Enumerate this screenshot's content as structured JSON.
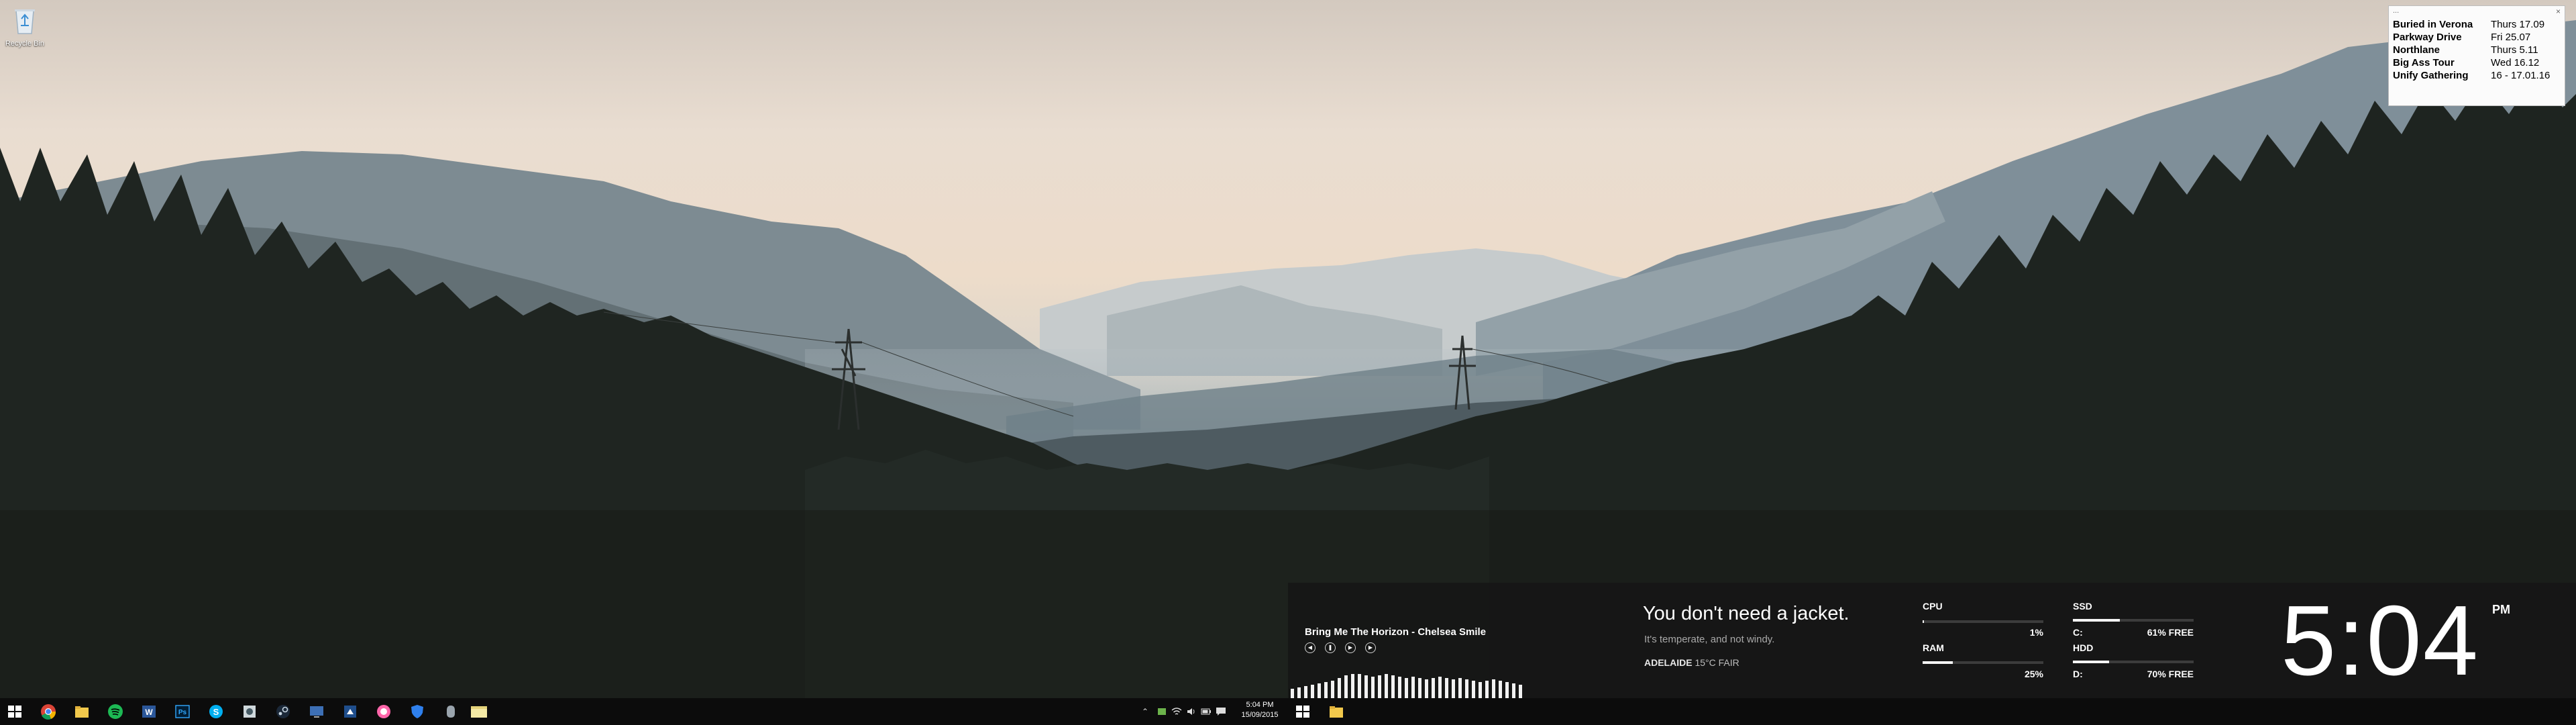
{
  "desktop": {
    "recycle_bin_label": "Recycle Bin"
  },
  "note": {
    "title_dots": "...",
    "close_glyph": "×",
    "rows": [
      {
        "band": "Buried in Verona",
        "date": "Thurs 17.09"
      },
      {
        "band": "Parkway Drive",
        "date": "Fri 25.07"
      },
      {
        "band": "Northlane",
        "date": "Thurs 5.11"
      },
      {
        "band": "Big Ass Tour",
        "date": "Wed 16.12"
      },
      {
        "band": "Unify Gathering",
        "date": "16 - 17.01.16"
      }
    ]
  },
  "now_playing": {
    "track": "Bring Me The Horizon - Chelsea Smile",
    "controls": [
      "prev-icon",
      "pause-icon",
      "play-icon",
      "next-icon"
    ]
  },
  "weather": {
    "headline": "You don't need a jacket.",
    "sub": "It's temperate, and not windy.",
    "location": "ADELAIDE",
    "temp_condition": "15°C FAIR"
  },
  "stats": {
    "cpu": {
      "label": "CPU",
      "value": "1%",
      "fraction": 0.01
    },
    "ram": {
      "label": "RAM",
      "value": "25%",
      "fraction": 0.25
    },
    "ssd": {
      "label": "SSD",
      "drive": "C:",
      "value": "61% FREE",
      "used_fraction": 0.39
    },
    "hdd": {
      "label": "HDD",
      "drive": "D:",
      "value": "70% FREE",
      "used_fraction": 0.3
    }
  },
  "clock": {
    "time": "5:04",
    "ampm": "PM"
  },
  "taskbar": {
    "time": "5:04 PM",
    "date": "15/09/2015",
    "pinned_icons": [
      "windows-start-icon",
      "chrome-icon",
      "file-explorer-icon",
      "spotify-icon",
      "word-icon",
      "photoshop-icon",
      "skype-icon",
      "app-icon",
      "steam-icon",
      "display-icon",
      "osu-icon",
      "shield-icon",
      "network-icon",
      "sticky-notes-icon"
    ],
    "tray_icons": [
      "chevron-up-icon",
      "wifi-icon",
      "speaker-icon",
      "battery-icon",
      "action-center-icon"
    ],
    "colors": {
      "accent": "#76b9ed",
      "spotify": "#1db954",
      "chrome_red": "#db4437"
    }
  }
}
